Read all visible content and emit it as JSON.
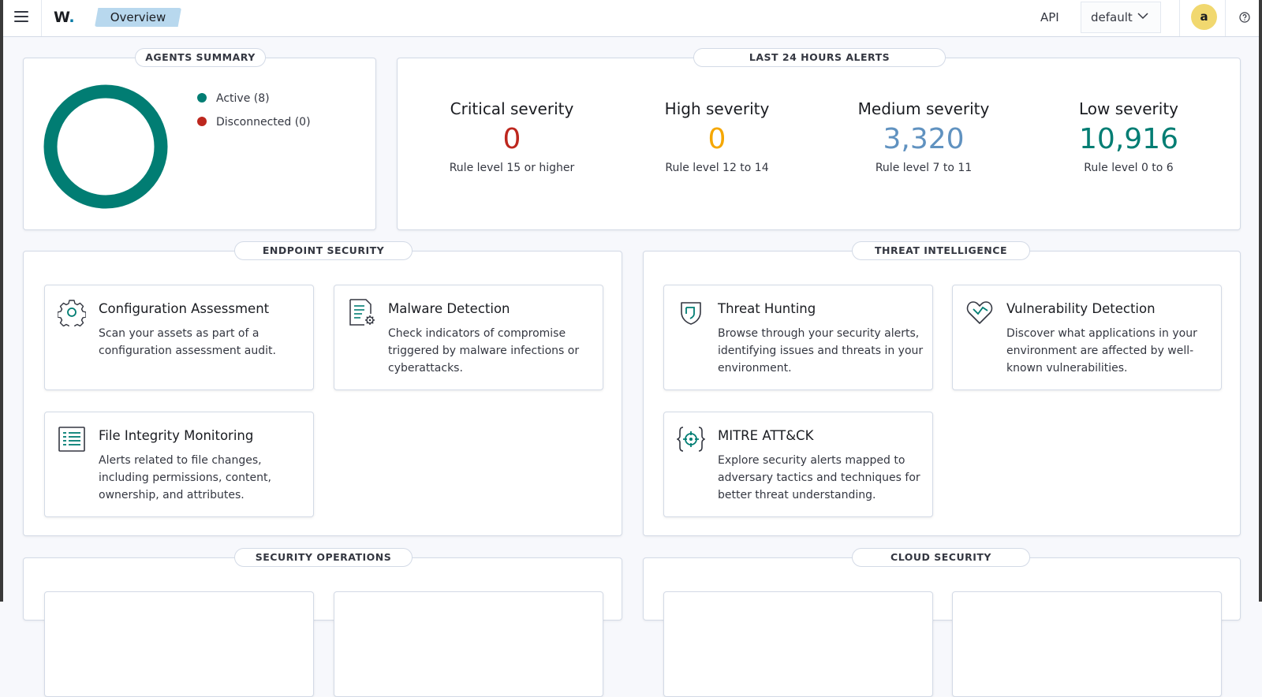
{
  "header": {
    "logo_text": "W",
    "logo_dot": ".",
    "breadcrumb": "Overview",
    "api_label": "API",
    "api_selected": "default",
    "avatar_initial": "a"
  },
  "agents_summary": {
    "title": "AGENTS SUMMARY",
    "legend": [
      {
        "label": "Active (8)",
        "color": "#017d73"
      },
      {
        "label": "Disconnected (0)",
        "color": "#bd271e"
      }
    ],
    "donut": {
      "active": 8,
      "disconnected": 0,
      "color": "#017d73"
    }
  },
  "alerts": {
    "title": "LAST 24 HOURS ALERTS",
    "items": [
      {
        "title": "Critical severity",
        "value": "0",
        "desc": "Rule level 15 or higher",
        "color": "#bd271e"
      },
      {
        "title": "High severity",
        "value": "0",
        "desc": "Rule level 12 to 14",
        "color": "#f5a700"
      },
      {
        "title": "Medium severity",
        "value": "3,320",
        "desc": "Rule level 7 to 11",
        "color": "#6092c0"
      },
      {
        "title": "Low severity",
        "value": "10,916",
        "desc": "Rule level 0 to 6",
        "color": "#017d73"
      }
    ]
  },
  "endpoint_security": {
    "title": "ENDPOINT SECURITY",
    "cards": [
      {
        "title": "Configuration Assessment",
        "desc": "Scan your assets as part of a configuration assessment audit.",
        "icon": "gear-icon"
      },
      {
        "title": "Malware Detection",
        "desc": "Check indicators of compromise triggered by malware infections or cyberattacks.",
        "icon": "document-gear-icon"
      },
      {
        "title": "File Integrity Monitoring",
        "desc": "Alerts related to file changes, including permissions, content, ownership, and attributes.",
        "icon": "list-icon"
      }
    ]
  },
  "threat_intelligence": {
    "title": "THREAT INTELLIGENCE",
    "cards": [
      {
        "title": "Threat Hunting",
        "desc": "Browse through your security alerts, identifying issues and threats in your environment.",
        "icon": "shield-icon"
      },
      {
        "title": "Vulnerability Detection",
        "desc": "Discover what applications in your environment are affected by well-known vulnerabilities.",
        "icon": "heart-icon"
      },
      {
        "title": "MITRE ATT&CK",
        "desc": "Explore security alerts mapped to adversary tactics and techniques for better threat understanding.",
        "icon": "target-icon"
      }
    ]
  },
  "security_operations": {
    "title": "SECURITY OPERATIONS"
  },
  "cloud_security": {
    "title": "CLOUD SECURITY"
  }
}
